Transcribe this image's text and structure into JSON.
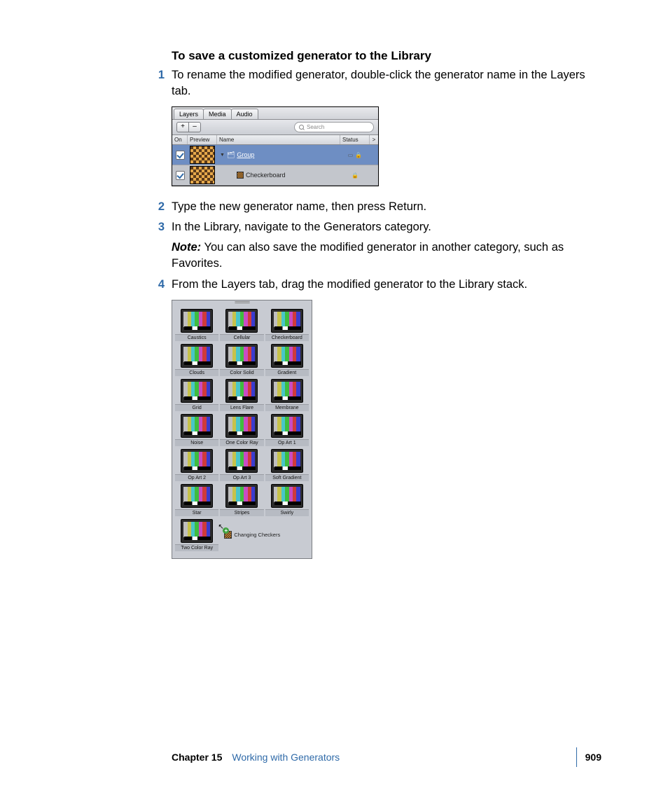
{
  "heading": "To save a customized generator to the Library",
  "steps": {
    "s1_num": "1",
    "s1_txt": "To rename the modified generator, double-click the generator name in the Layers tab.",
    "s2_num": "2",
    "s2_txt": "Type the new generator name, then press Return.",
    "s3_num": "3",
    "s3_txt": "In the Library, navigate to the Generators category.",
    "note_label": "Note:",
    "note_txt": "  You can also save the modified generator in another category, such as Favorites.",
    "s4_num": "4",
    "s4_txt": "From the Layers tab, drag the modified generator to the Library stack."
  },
  "layers_panel": {
    "tabs": {
      "layers": "Layers",
      "media": "Media",
      "audio": "Audio"
    },
    "plus": "+",
    "minus": "–",
    "search_placeholder": "Search",
    "columns": {
      "on": "On",
      "preview": "Preview",
      "name": "Name",
      "status": "Status",
      "chev": ">"
    },
    "group_label": "Group",
    "item_label": "Checkerboard"
  },
  "library": {
    "items": [
      "Caustics",
      "Cellular",
      "Checkerboard",
      "Clouds",
      "Color Solid",
      "Gradient",
      "Grid",
      "Lens Flare",
      "Membrane",
      "Noise",
      "One Color Ray",
      "Op Art 1",
      "Op Art 2",
      "Op Art 3",
      "Soft Gradient",
      "Star",
      "Stripes",
      "Swirly",
      "Two Color Ray"
    ],
    "drag_label": "Changing Checkers",
    "plus_badge": "+"
  },
  "footer": {
    "chapter": "Chapter 15",
    "title": "Working with Generators",
    "page": "909"
  }
}
